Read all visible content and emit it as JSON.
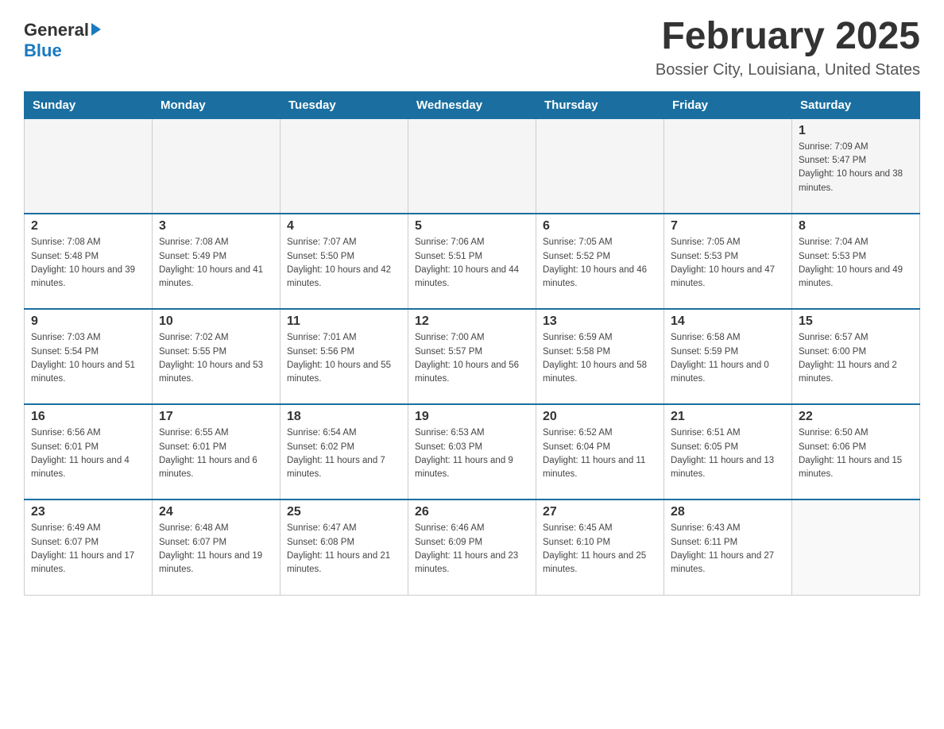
{
  "header": {
    "logo": {
      "general": "General",
      "blue": "Blue"
    },
    "title": "February 2025",
    "location": "Bossier City, Louisiana, United States"
  },
  "calendar": {
    "days_of_week": [
      "Sunday",
      "Monday",
      "Tuesday",
      "Wednesday",
      "Thursday",
      "Friday",
      "Saturday"
    ],
    "weeks": [
      {
        "days": [
          {
            "number": "",
            "info": ""
          },
          {
            "number": "",
            "info": ""
          },
          {
            "number": "",
            "info": ""
          },
          {
            "number": "",
            "info": ""
          },
          {
            "number": "",
            "info": ""
          },
          {
            "number": "",
            "info": ""
          },
          {
            "number": "1",
            "info": "Sunrise: 7:09 AM\nSunset: 5:47 PM\nDaylight: 10 hours and 38 minutes."
          }
        ]
      },
      {
        "days": [
          {
            "number": "2",
            "info": "Sunrise: 7:08 AM\nSunset: 5:48 PM\nDaylight: 10 hours and 39 minutes."
          },
          {
            "number": "3",
            "info": "Sunrise: 7:08 AM\nSunset: 5:49 PM\nDaylight: 10 hours and 41 minutes."
          },
          {
            "number": "4",
            "info": "Sunrise: 7:07 AM\nSunset: 5:50 PM\nDaylight: 10 hours and 42 minutes."
          },
          {
            "number": "5",
            "info": "Sunrise: 7:06 AM\nSunset: 5:51 PM\nDaylight: 10 hours and 44 minutes."
          },
          {
            "number": "6",
            "info": "Sunrise: 7:05 AM\nSunset: 5:52 PM\nDaylight: 10 hours and 46 minutes."
          },
          {
            "number": "7",
            "info": "Sunrise: 7:05 AM\nSunset: 5:53 PM\nDaylight: 10 hours and 47 minutes."
          },
          {
            "number": "8",
            "info": "Sunrise: 7:04 AM\nSunset: 5:53 PM\nDaylight: 10 hours and 49 minutes."
          }
        ]
      },
      {
        "days": [
          {
            "number": "9",
            "info": "Sunrise: 7:03 AM\nSunset: 5:54 PM\nDaylight: 10 hours and 51 minutes."
          },
          {
            "number": "10",
            "info": "Sunrise: 7:02 AM\nSunset: 5:55 PM\nDaylight: 10 hours and 53 minutes."
          },
          {
            "number": "11",
            "info": "Sunrise: 7:01 AM\nSunset: 5:56 PM\nDaylight: 10 hours and 55 minutes."
          },
          {
            "number": "12",
            "info": "Sunrise: 7:00 AM\nSunset: 5:57 PM\nDaylight: 10 hours and 56 minutes."
          },
          {
            "number": "13",
            "info": "Sunrise: 6:59 AM\nSunset: 5:58 PM\nDaylight: 10 hours and 58 minutes."
          },
          {
            "number": "14",
            "info": "Sunrise: 6:58 AM\nSunset: 5:59 PM\nDaylight: 11 hours and 0 minutes."
          },
          {
            "number": "15",
            "info": "Sunrise: 6:57 AM\nSunset: 6:00 PM\nDaylight: 11 hours and 2 minutes."
          }
        ]
      },
      {
        "days": [
          {
            "number": "16",
            "info": "Sunrise: 6:56 AM\nSunset: 6:01 PM\nDaylight: 11 hours and 4 minutes."
          },
          {
            "number": "17",
            "info": "Sunrise: 6:55 AM\nSunset: 6:01 PM\nDaylight: 11 hours and 6 minutes."
          },
          {
            "number": "18",
            "info": "Sunrise: 6:54 AM\nSunset: 6:02 PM\nDaylight: 11 hours and 7 minutes."
          },
          {
            "number": "19",
            "info": "Sunrise: 6:53 AM\nSunset: 6:03 PM\nDaylight: 11 hours and 9 minutes."
          },
          {
            "number": "20",
            "info": "Sunrise: 6:52 AM\nSunset: 6:04 PM\nDaylight: 11 hours and 11 minutes."
          },
          {
            "number": "21",
            "info": "Sunrise: 6:51 AM\nSunset: 6:05 PM\nDaylight: 11 hours and 13 minutes."
          },
          {
            "number": "22",
            "info": "Sunrise: 6:50 AM\nSunset: 6:06 PM\nDaylight: 11 hours and 15 minutes."
          }
        ]
      },
      {
        "days": [
          {
            "number": "23",
            "info": "Sunrise: 6:49 AM\nSunset: 6:07 PM\nDaylight: 11 hours and 17 minutes."
          },
          {
            "number": "24",
            "info": "Sunrise: 6:48 AM\nSunset: 6:07 PM\nDaylight: 11 hours and 19 minutes."
          },
          {
            "number": "25",
            "info": "Sunrise: 6:47 AM\nSunset: 6:08 PM\nDaylight: 11 hours and 21 minutes."
          },
          {
            "number": "26",
            "info": "Sunrise: 6:46 AM\nSunset: 6:09 PM\nDaylight: 11 hours and 23 minutes."
          },
          {
            "number": "27",
            "info": "Sunrise: 6:45 AM\nSunset: 6:10 PM\nDaylight: 11 hours and 25 minutes."
          },
          {
            "number": "28",
            "info": "Sunrise: 6:43 AM\nSunset: 6:11 PM\nDaylight: 11 hours and 27 minutes."
          },
          {
            "number": "",
            "info": ""
          }
        ]
      }
    ]
  }
}
